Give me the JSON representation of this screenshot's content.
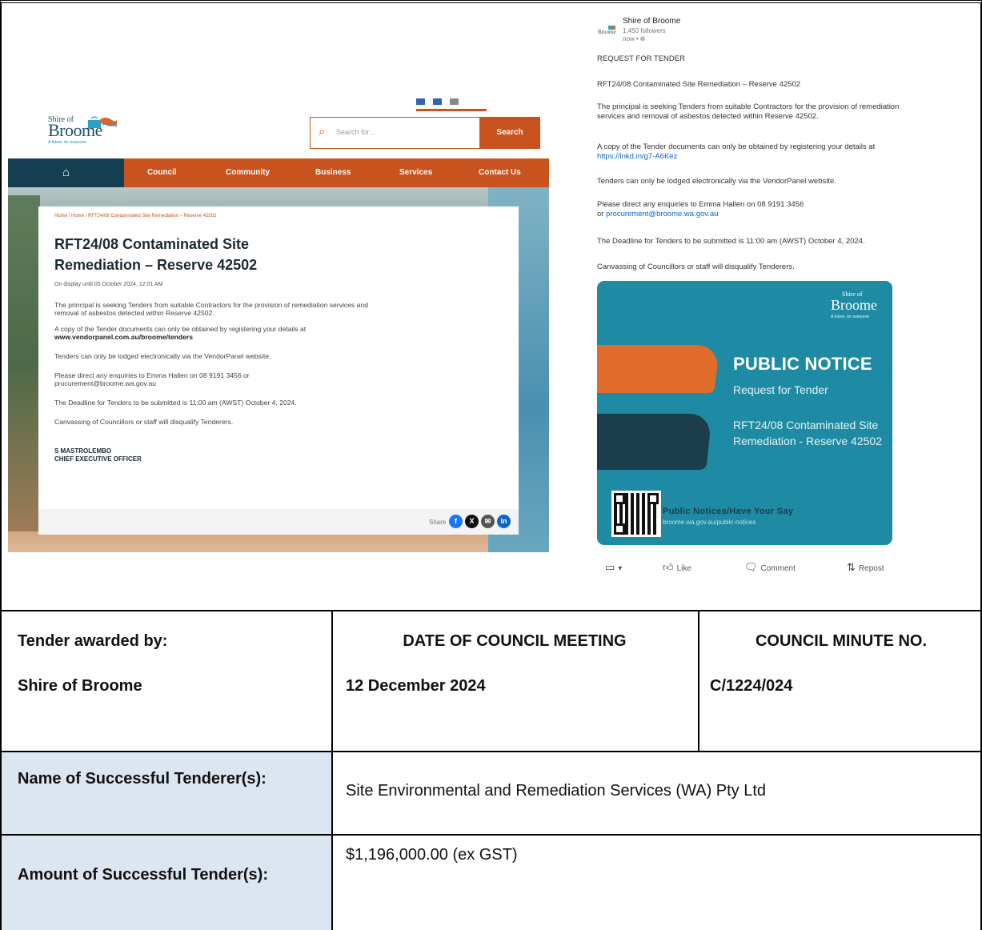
{
  "website": {
    "logo": {
      "line1": "Shire of",
      "line2": "Broome",
      "tagline": "A future, for everyone"
    },
    "search": {
      "placeholder": "Search for...",
      "button": "Search"
    },
    "nav": {
      "home_icon": "home-icon",
      "items": [
        "Council",
        "Community",
        "Business",
        "Services",
        "Contact Us"
      ]
    },
    "breadcrumb": "Home  /  Home  /  RFT24/08 Contaminated Site Remediation – Reserve 42502",
    "title": "RFT24/08 Contaminated Site Remediation – Reserve 42502",
    "display_until": "On display until 05 October 2024, 12:01 AM",
    "para1": "The principal is seeking Tenders from suitable Contractors for the provision of remediation services and removal of asbestos detected within Reserve 42502.",
    "para2a": "A copy of the Tender documents can only be obtained by registering your details at",
    "para2b": "www.vendorpanel.com.au/broome/tenders",
    "para3": "Tenders can only be lodged electronically via the VendorPanel website.",
    "para4": "Please direct any enquiries to Emma Hallen on 08 9191 3456 or procurement@broome.wa.gov.au",
    "para5": "The Deadline for Tenders to be submitted is 11:00 am (AWST) October  4, 2024.",
    "para6": "Canvassing of Councillors or staff will disqualify Tenderers.",
    "signatory_name": "S MASTROLEMBO",
    "signatory_title": "CHIEF EXECUTIVE OFFICER",
    "share_label": "Share",
    "colors": {
      "orange": "#c9531e",
      "dark_teal": "#143f50"
    }
  },
  "post": {
    "author": "Shire of Broome",
    "followers": "1,450 followers",
    "time": "now • ",
    "l1": "REQUEST FOR TENDER",
    "l2": "RFT24/08 Contaminated Site Remediation – Reserve 42502",
    "l3": "The principal is seeking Tenders from suitable Contractors for the provision of remediation services and removal of asbestos detected within Reserve 42502.",
    "l4a": "A copy of the Tender documents can only be obtained by registering your details at ",
    "l4b": "https://lnkd.in/g7-A6Kez",
    "l5": "Tenders can only be lodged electronically via the VendorPanel website.",
    "l6a": "Please direct any enquiries to Emma Hallen on 08 9191 3456",
    "l6b": "or ",
    "l6c": "procurement@broome.wa.gov.au",
    "l7": "The Deadline for Tenders to be submitted is 11:00 am (AWST) October  4, 2024.",
    "l8": "Canvassing of Councillors or staff will disqualify Tenderers.",
    "notice": {
      "logo_line1": "Shire of",
      "logo_line2": "Broome",
      "logo_tag": "A future, for everyone",
      "heading": "PUBLIC NOTICE",
      "sub": "Request for Tender",
      "desc": "RFT24/08 Contaminated Site Remediation - Reserve 42502",
      "footer_title": "Public Notices/Have Your Say",
      "footer_url": "broome.wa.gov.au/public-notices",
      "color": "#1f8aa3"
    },
    "actions": {
      "like": "Like",
      "comment": "Comment",
      "repost": "Repost"
    }
  },
  "table": {
    "awarded_by_label": "Tender awarded by:",
    "awarded_by_value": "Shire of Broome",
    "meeting_label": "DATE OF COUNCIL MEETING",
    "meeting_value": "12 December 2024",
    "minute_label": "COUNCIL MINUTE NO.",
    "minute_value": "C/1224/024",
    "tenderer_label": "Name of Successful Tenderer(s):",
    "tenderer_value": "Site Environmental and Remediation Services (WA) Pty Ltd",
    "amount_label": "Amount of Successful Tender(s):",
    "amount_value": "$1,196,000.00 (ex GST)",
    "label_shade": "#dce6f1"
  }
}
